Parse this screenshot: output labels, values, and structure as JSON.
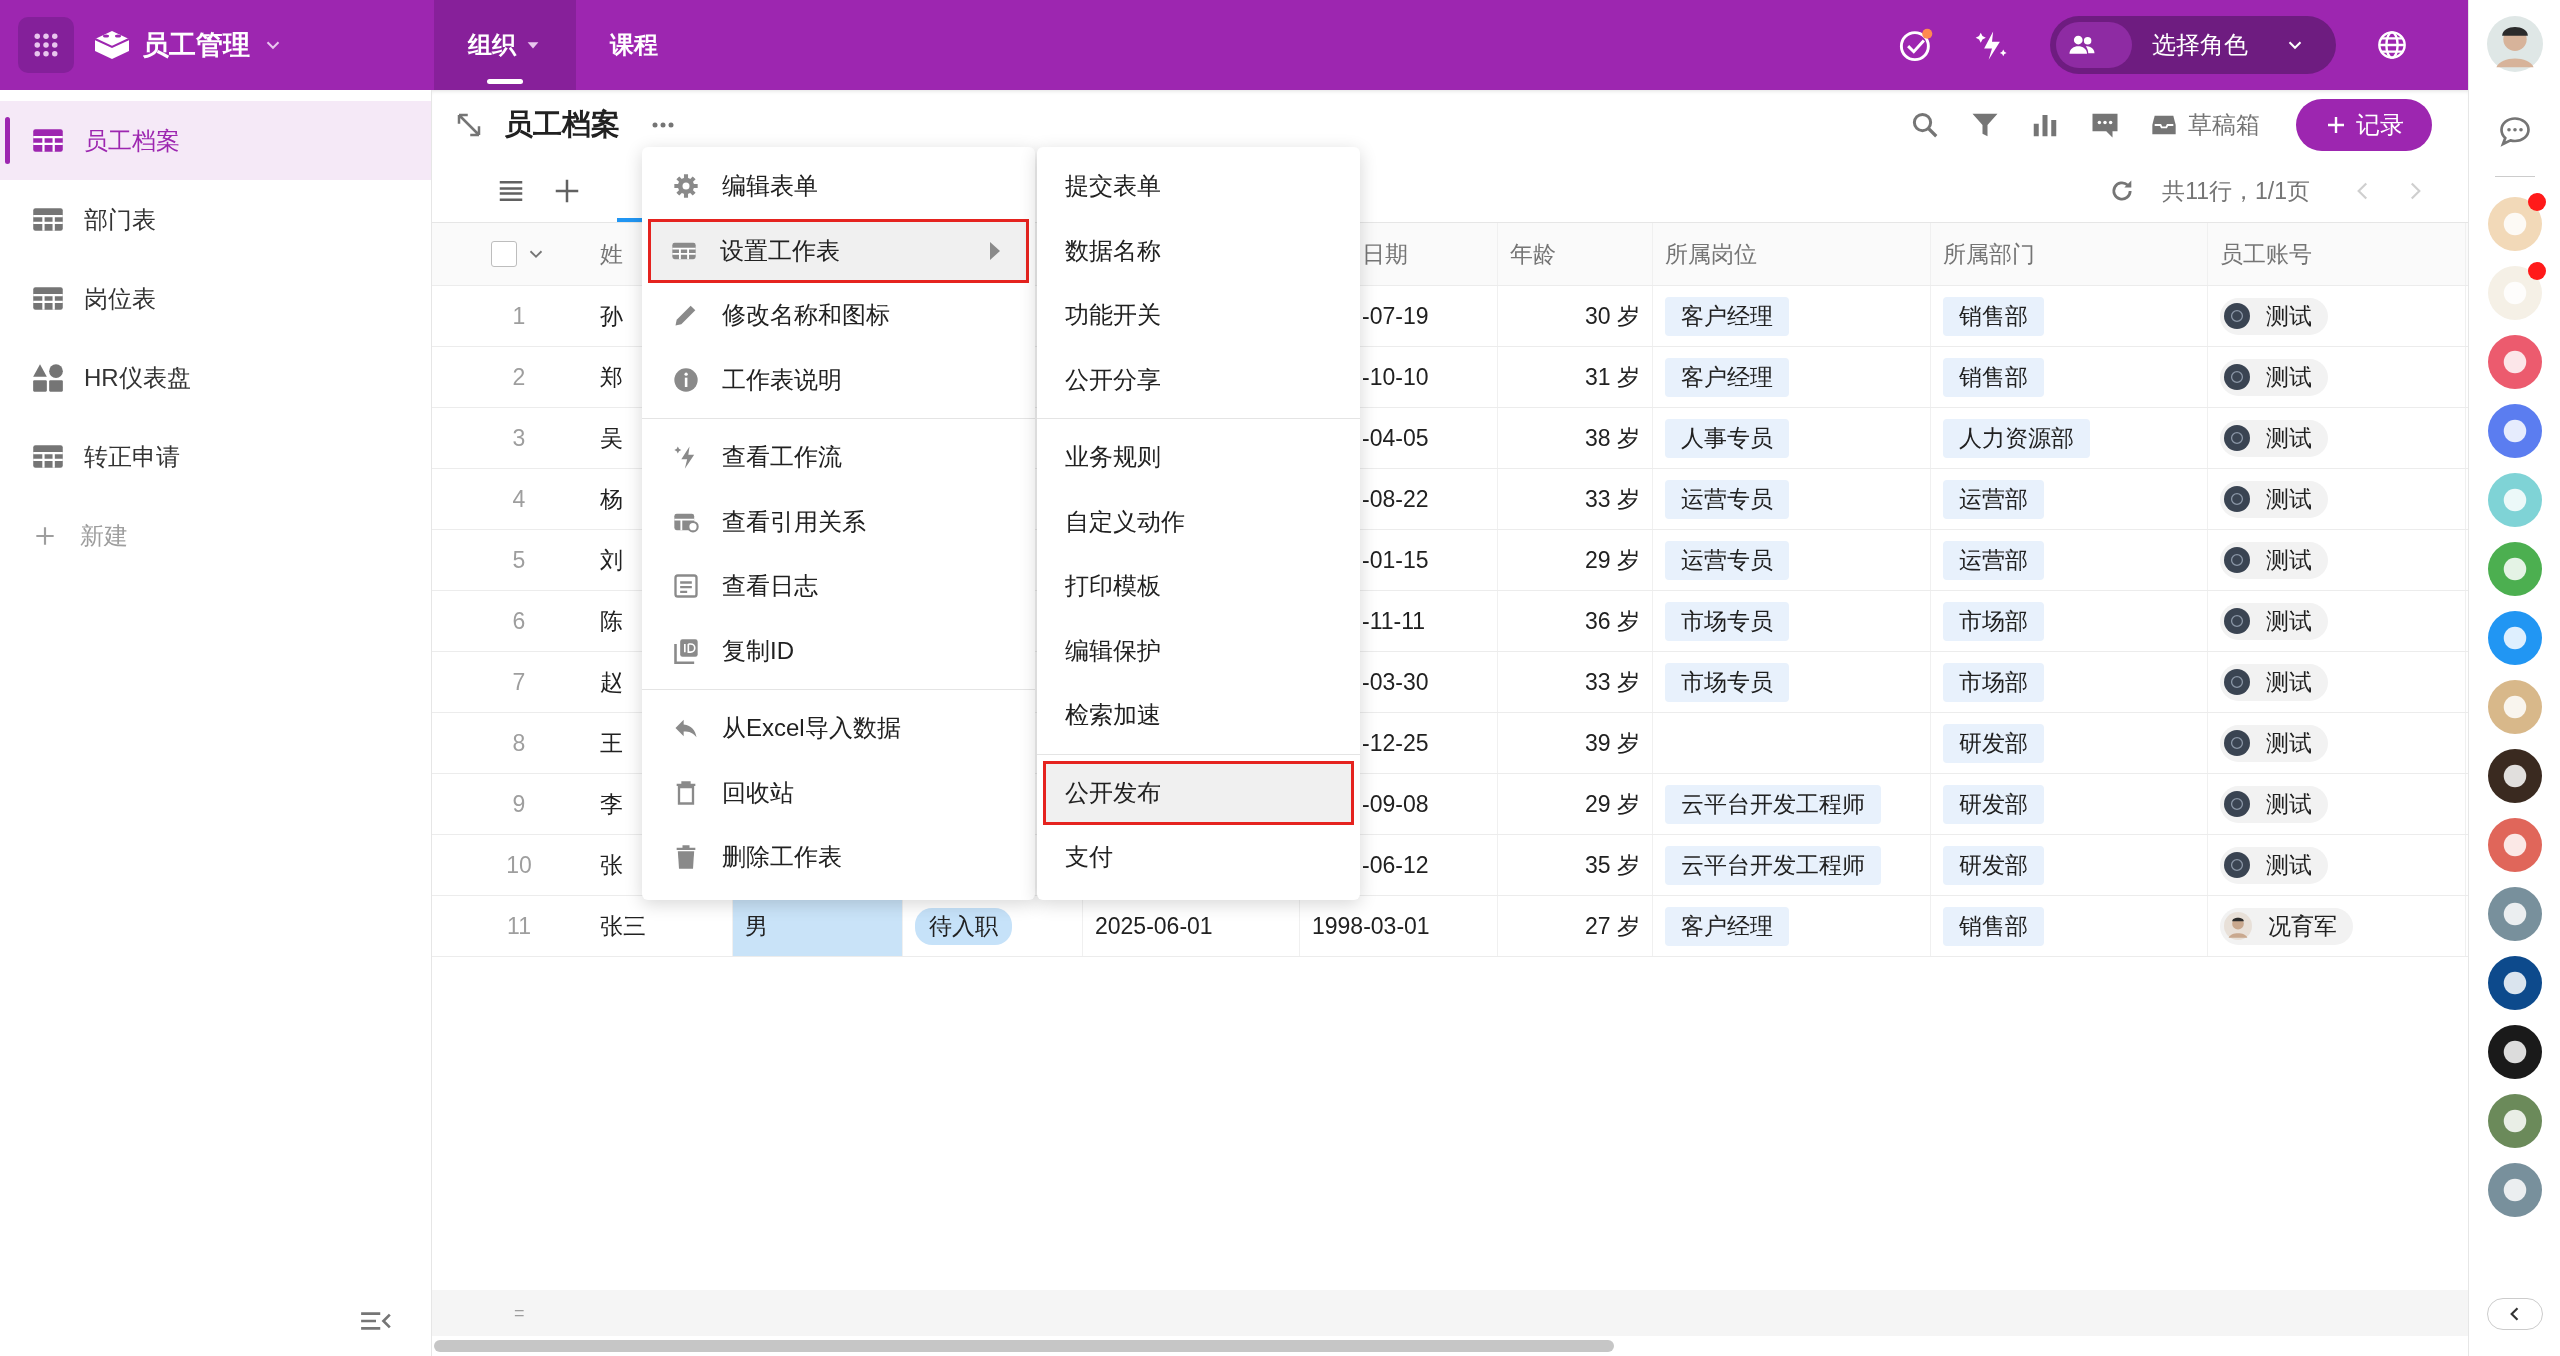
{
  "app": {
    "title": "员工管理"
  },
  "nav_tabs": [
    {
      "label": "组织",
      "selected": true,
      "has_dropdown": true
    },
    {
      "label": "课程",
      "selected": false,
      "has_dropdown": false
    }
  ],
  "notifications": {
    "unread": true
  },
  "role_selector": {
    "label": "选择角色"
  },
  "sidebar": {
    "items": [
      {
        "label": "员工档案",
        "selected": true,
        "kind": "table"
      },
      {
        "label": "部门表",
        "selected": false,
        "kind": "table"
      },
      {
        "label": "岗位表",
        "selected": false,
        "kind": "table"
      },
      {
        "label": "HR仪表盘",
        "selected": false,
        "kind": "dashboard"
      },
      {
        "label": "转正申请",
        "selected": false,
        "kind": "table"
      }
    ],
    "new_item": {
      "label": "新建"
    }
  },
  "sheet": {
    "title": "员工档案"
  },
  "toolbar": {
    "drafts": "草稿箱",
    "add_record": "记录"
  },
  "pagination": {
    "summary": "共11行，1/1页"
  },
  "table": {
    "select_all": {
      "checked": false
    },
    "headers": {
      "name": "姓",
      "date": "日期",
      "age": "年龄",
      "position": "所属岗位",
      "department": "所属部门",
      "account": "员工账号"
    },
    "rows": [
      {
        "number": "1",
        "name": "孙",
        "date": "-07-19",
        "age": "30 岁",
        "position": "客户经理",
        "department": "销售部",
        "account": {
          "name": "测试",
          "kind": "logo"
        }
      },
      {
        "number": "2",
        "name": "郑",
        "date": "-10-10",
        "age": "31 岁",
        "position": "客户经理",
        "department": "销售部",
        "account": {
          "name": "测试",
          "kind": "logo"
        }
      },
      {
        "number": "3",
        "name": "吴",
        "date": "-04-05",
        "age": "38 岁",
        "position": "人事专员",
        "department": "人力资源部",
        "account": {
          "name": "测试",
          "kind": "logo"
        }
      },
      {
        "number": "4",
        "name": "杨",
        "date": "-08-22",
        "age": "33 岁",
        "position": "运营专员",
        "department": "运营部",
        "account": {
          "name": "测试",
          "kind": "logo"
        }
      },
      {
        "number": "5",
        "name": "刘",
        "date": "-01-15",
        "age": "29 岁",
        "position": "运营专员",
        "department": "运营部",
        "account": {
          "name": "测试",
          "kind": "logo"
        }
      },
      {
        "number": "6",
        "name": "陈",
        "date": "-11-11",
        "age": "36 岁",
        "position": "市场专员",
        "department": "市场部",
        "account": {
          "name": "测试",
          "kind": "logo"
        }
      },
      {
        "number": "7",
        "name": "赵",
        "date": "-03-30",
        "age": "33 岁",
        "position": "市场专员",
        "department": "市场部",
        "account": {
          "name": "测试",
          "kind": "logo"
        }
      },
      {
        "number": "8",
        "name": "王",
        "date": "-12-25",
        "age": "39 岁",
        "department": "研发部",
        "account": {
          "name": "测试",
          "kind": "logo"
        }
      },
      {
        "number": "9",
        "name": "李",
        "date": "-09-08",
        "age": "29 岁",
        "position": "云平台开发工程师",
        "department": "研发部",
        "account": {
          "name": "测试",
          "kind": "logo"
        }
      },
      {
        "number": "10",
        "name": "张",
        "date": "-06-12",
        "age": "35 岁",
        "position": "云平台开发工程师",
        "department": "研发部",
        "account": {
          "name": "测试",
          "kind": "logo"
        }
      },
      {
        "number": "11",
        "name": "张三",
        "gender": "男",
        "gender_selected": true,
        "status": "待入职",
        "column_5": "2025-06-01",
        "date": "1998-03-01",
        "age": "27 岁",
        "position": "客户经理",
        "department": "销售部",
        "account": {
          "name": "况育军",
          "kind": "person"
        }
      }
    ],
    "summary_row": {
      "symbol": "="
    }
  },
  "context_menu": {
    "groups": [
      [
        {
          "label": "编辑表单",
          "has_submenu": false,
          "highlighted": false
        },
        {
          "label": "设置工作表",
          "has_submenu": true,
          "highlighted": true
        },
        {
          "label": "修改名称和图标",
          "has_submenu": false,
          "highlighted": false
        },
        {
          "label": "工作表说明",
          "has_submenu": false,
          "highlighted": false
        }
      ],
      [
        {
          "label": "查看工作流",
          "has_submenu": false,
          "highlighted": false
        },
        {
          "label": "查看引用关系",
          "has_submenu": false,
          "highlighted": false
        },
        {
          "label": "查看日志",
          "has_submenu": false,
          "highlighted": false
        },
        {
          "label": "复制ID",
          "has_submenu": false,
          "highlighted": false
        }
      ],
      [
        {
          "label": "从Excel导入数据",
          "has_submenu": false,
          "highlighted": false
        },
        {
          "label": "回收站",
          "has_submenu": false,
          "highlighted": false
        },
        {
          "label": "删除工作表",
          "has_submenu": false,
          "highlighted": false
        }
      ]
    ]
  },
  "submenu": {
    "groups": [
      [
        {
          "label": "提交表单",
          "highlighted": false
        },
        {
          "label": "数据名称",
          "highlighted": false
        },
        {
          "label": "功能开关",
          "highlighted": false
        },
        {
          "label": "公开分享",
          "highlighted": false
        }
      ],
      [
        {
          "label": "业务规则",
          "highlighted": false
        },
        {
          "label": "自定义动作",
          "highlighted": false
        },
        {
          "label": "打印模板",
          "highlighted": false
        },
        {
          "label": "编辑保护",
          "highlighted": false
        },
        {
          "label": "检索加速",
          "highlighted": false
        }
      ],
      [
        {
          "label": "公开发布",
          "highlighted": true
        },
        {
          "label": "支付",
          "highlighted": false
        }
      ]
    ]
  },
  "app_rail": [
    {
      "color": "#f2d9b8",
      "badge": true
    },
    {
      "color": "#f5f0e6",
      "badge": true
    },
    {
      "color": "#ec5b6e",
      "badge": false
    },
    {
      "color": "#5b7df0",
      "badge": false
    },
    {
      "color": "#7fd3d6",
      "badge": false
    },
    {
      "color": "#4caf50",
      "badge": false
    },
    {
      "color": "#2196f3",
      "badge": false
    },
    {
      "color": "#d8b88a",
      "badge": false
    },
    {
      "color": "#3a2a20",
      "badge": false
    },
    {
      "color": "#e0665a",
      "badge": false
    },
    {
      "color": "#78909c",
      "badge": false
    },
    {
      "color": "#0d4a8c",
      "badge": false
    },
    {
      "color": "#1a1a1a",
      "badge": false
    },
    {
      "color": "#6b8a5a",
      "badge": false
    },
    {
      "color": "#78909c",
      "badge": false
    }
  ]
}
